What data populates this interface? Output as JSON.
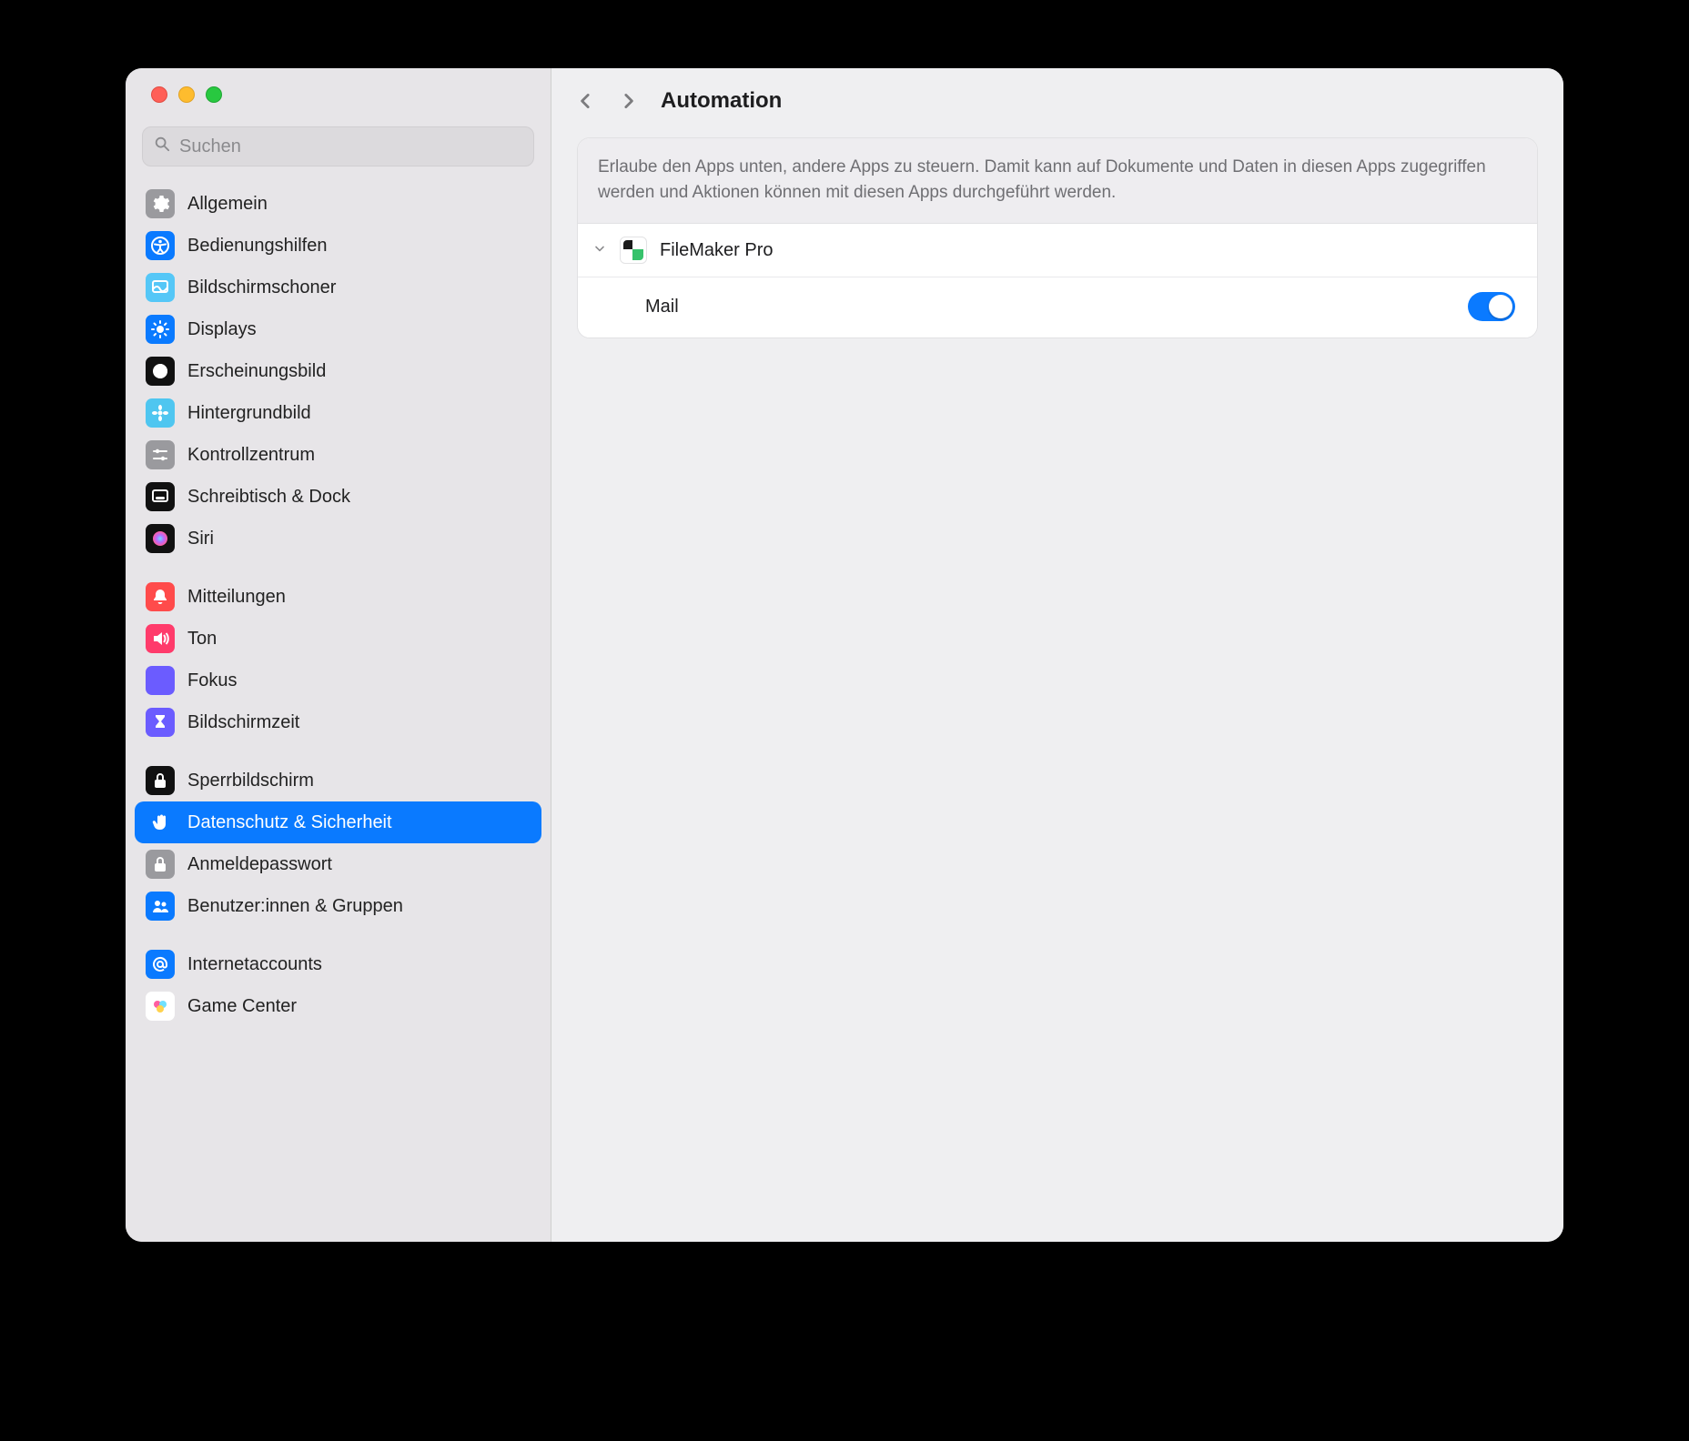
{
  "window": {
    "traffic_lights": [
      "close",
      "minimize",
      "zoom"
    ]
  },
  "search": {
    "placeholder": "Suchen"
  },
  "sidebar_groups": [
    {
      "items": [
        {
          "id": "allgemein",
          "label": "Allgemein",
          "icon": "gear",
          "bg": "#9a9a9e"
        },
        {
          "id": "bedienungshilfen",
          "label": "Bedienungshilfen",
          "icon": "accessibility",
          "bg": "#0a7aff"
        },
        {
          "id": "bildschirmschoner",
          "label": "Bildschirmschoner",
          "icon": "screensaver",
          "bg": "#55c7f7"
        },
        {
          "id": "displays",
          "label": "Displays",
          "icon": "sun",
          "bg": "#0a7aff"
        },
        {
          "id": "erscheinungsbild",
          "label": "Erscheinungsbild",
          "icon": "appearance",
          "bg": "#111"
        },
        {
          "id": "hintergrundbild",
          "label": "Hintergrundbild",
          "icon": "flower",
          "bg": "#4fc6f0"
        },
        {
          "id": "kontrollzentrum",
          "label": "Kontrollzentrum",
          "icon": "sliders",
          "bg": "#9a9a9e"
        },
        {
          "id": "schreibtisch-dock",
          "label": "Schreibtisch & Dock",
          "icon": "dock",
          "bg": "#111"
        },
        {
          "id": "siri",
          "label": "Siri",
          "icon": "siri",
          "bg": "#111"
        }
      ]
    },
    {
      "items": [
        {
          "id": "mitteilungen",
          "label": "Mitteilungen",
          "icon": "bell",
          "bg": "#ff4b4b"
        },
        {
          "id": "ton",
          "label": "Ton",
          "icon": "speaker",
          "bg": "#ff3b6b"
        },
        {
          "id": "fokus",
          "label": "Fokus",
          "icon": "moon",
          "bg": "#6b5cff"
        },
        {
          "id": "bildschirmzeit",
          "label": "Bildschirmzeit",
          "icon": "hourglass",
          "bg": "#6b5cff"
        }
      ]
    },
    {
      "items": [
        {
          "id": "sperrbildschirm",
          "label": "Sperrbildschirm",
          "icon": "lock",
          "bg": "#111"
        },
        {
          "id": "datenschutz",
          "label": "Datenschutz & Sicherheit",
          "icon": "hand",
          "bg": "#0a7aff",
          "selected": true
        },
        {
          "id": "anmeldepasswort",
          "label": "Anmeldepasswort",
          "icon": "lock",
          "bg": "#9a9a9e"
        },
        {
          "id": "benutzer",
          "label": "Benutzer:innen & Gruppen",
          "icon": "users",
          "bg": "#0a7aff"
        }
      ]
    },
    {
      "items": [
        {
          "id": "internetaccounts",
          "label": "Internetaccounts",
          "icon": "at",
          "bg": "#0a7aff"
        },
        {
          "id": "gamecenter",
          "label": "Game Center",
          "icon": "gamecenter",
          "bg": "#fff"
        }
      ]
    }
  ],
  "content": {
    "title": "Automation",
    "description": "Erlaube den Apps unten, andere Apps zu steuern. Damit kann auf Dokumente und Daten in diesen Apps zugegriffen werden und Aktionen können mit diesen Apps durchgeführt werden.",
    "apps": [
      {
        "name": "FileMaker Pro",
        "expanded": true,
        "controlled": [
          {
            "name": "Mail",
            "enabled": true
          }
        ]
      }
    ]
  }
}
